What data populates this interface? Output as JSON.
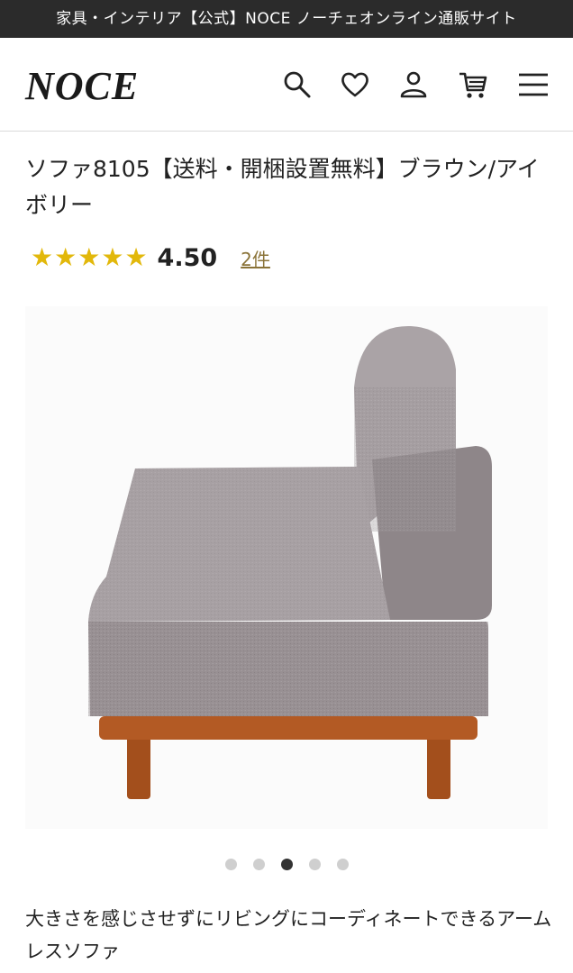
{
  "top_banner": {
    "text": "家具・インテリア【公式】NOCE ノーチェオンライン通販サイト"
  },
  "header": {
    "logo": "NOCE",
    "icons": [
      "search-icon",
      "heart-icon",
      "user-icon",
      "cart-icon",
      "menu-icon"
    ]
  },
  "product": {
    "title": "ソファ8105【送料・開梱設置無料】ブラウン/アイボリー",
    "rating_value": "4.50",
    "rating_stars": 5,
    "reviews_link": "2件",
    "description": "大きさを感じさせずにリビングにコーディネートできるアームレスソファ"
  },
  "gallery": {
    "dot_count": 5,
    "active_index": 2
  },
  "colors": {
    "star": "#e2b80b",
    "topbar_bg": "#2b2b2b",
    "fabric": "#9c9598",
    "wood": "#b35a24"
  }
}
